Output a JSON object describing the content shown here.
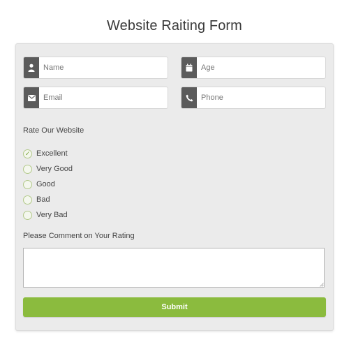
{
  "page": {
    "title": "Website Raiting Form"
  },
  "fields": {
    "name": {
      "placeholder": "Name",
      "icon": "person-icon"
    },
    "age": {
      "placeholder": "Age",
      "icon": "calendar-icon"
    },
    "email": {
      "placeholder": "Email",
      "icon": "envelope-icon"
    },
    "phone": {
      "placeholder": "Phone",
      "icon": "phone-icon"
    }
  },
  "rating": {
    "label": "Rate Our Website",
    "options": [
      "Excellent",
      "Very Good",
      "Good",
      "Bad",
      "Very Bad"
    ],
    "selected": "Excellent"
  },
  "comment": {
    "label": "Please Comment on Your Rating",
    "value": ""
  },
  "submit": {
    "label": "Submit"
  },
  "colors": {
    "accent": "#8bbb3e",
    "icon_bg": "#5b5b5b",
    "panel_bg": "#ebebeb"
  }
}
